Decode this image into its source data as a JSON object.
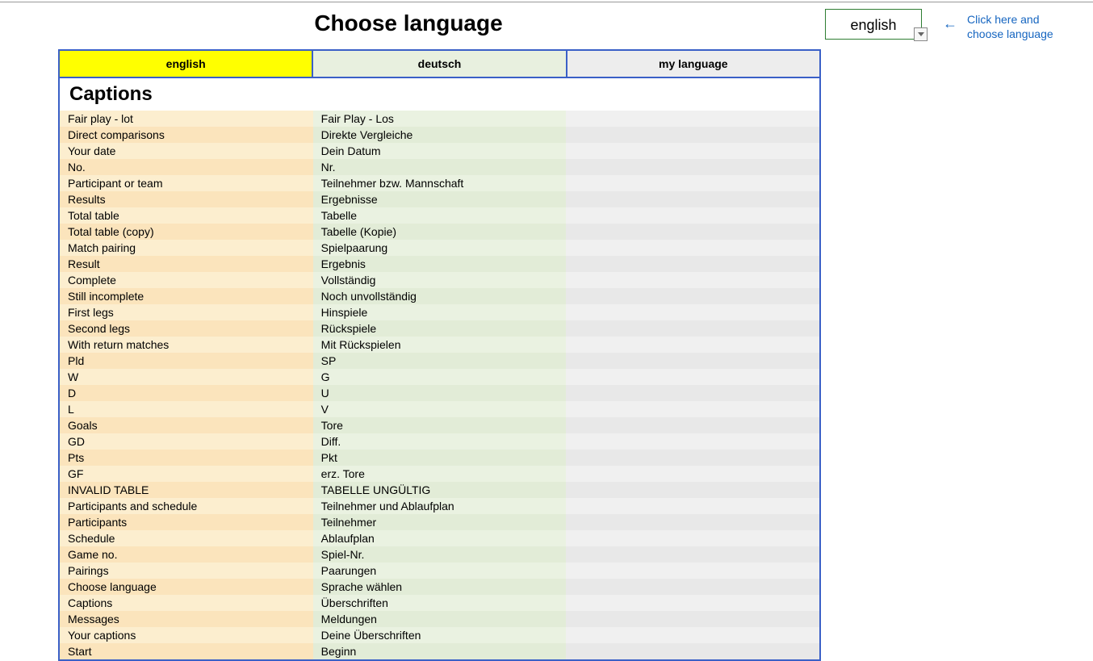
{
  "title": "Choose language",
  "language_selector": {
    "value": "english"
  },
  "hint": {
    "arrow": "←",
    "line1": "Click here and",
    "line2": "choose language"
  },
  "columns": {
    "en": "english",
    "de": "deutsch",
    "my": "my language"
  },
  "section_title": "Captions",
  "rows": [
    {
      "en": "Fair play - lot",
      "de": "Fair Play - Los",
      "my": ""
    },
    {
      "en": "Direct comparisons",
      "de": "Direkte Vergleiche",
      "my": ""
    },
    {
      "en": "Your date",
      "de": "Dein Datum",
      "my": ""
    },
    {
      "en": "No.",
      "de": "Nr.",
      "my": ""
    },
    {
      "en": "Participant or team",
      "de": "Teilnehmer bzw. Mannschaft",
      "my": ""
    },
    {
      "en": "Results",
      "de": "Ergebnisse",
      "my": ""
    },
    {
      "en": "Total table",
      "de": "Tabelle",
      "my": ""
    },
    {
      "en": "Total table (copy)",
      "de": "Tabelle (Kopie)",
      "my": ""
    },
    {
      "en": "Match pairing",
      "de": "Spielpaarung",
      "my": ""
    },
    {
      "en": "Result",
      "de": "Ergebnis",
      "my": ""
    },
    {
      "en": "Complete",
      "de": "Vollständig",
      "my": ""
    },
    {
      "en": "Still incomplete",
      "de": "Noch unvollständig",
      "my": ""
    },
    {
      "en": "First legs",
      "de": "Hinspiele",
      "my": ""
    },
    {
      "en": "Second legs",
      "de": "Rückspiele",
      "my": ""
    },
    {
      "en": "With return matches",
      "de": "Mit Rückspielen",
      "my": ""
    },
    {
      "en": "Pld",
      "de": "SP",
      "my": ""
    },
    {
      "en": "W",
      "de": "G",
      "my": ""
    },
    {
      "en": "D",
      "de": "U",
      "my": ""
    },
    {
      "en": "L",
      "de": "V",
      "my": ""
    },
    {
      "en": "Goals",
      "de": "Tore",
      "my": ""
    },
    {
      "en": "GD",
      "de": "Diff.",
      "my": ""
    },
    {
      "en": "Pts",
      "de": "Pkt",
      "my": ""
    },
    {
      "en": "GF",
      "de": "erz. Tore",
      "my": ""
    },
    {
      "en": "INVALID TABLE",
      "de": "TABELLE UNGÜLTIG",
      "my": ""
    },
    {
      "en": "Participants and schedule",
      "de": "Teilnehmer und Ablaufplan",
      "my": ""
    },
    {
      "en": "Participants",
      "de": "Teilnehmer",
      "my": ""
    },
    {
      "en": "Schedule",
      "de": "Ablaufplan",
      "my": ""
    },
    {
      "en": "Game no.",
      "de": "Spiel-Nr.",
      "my": ""
    },
    {
      "en": "Pairings",
      "de": "Paarungen",
      "my": ""
    },
    {
      "en": "Choose language",
      "de": "Sprache wählen",
      "my": ""
    },
    {
      "en": "Captions",
      "de": "Überschriften",
      "my": ""
    },
    {
      "en": "Messages",
      "de": "Meldungen",
      "my": ""
    },
    {
      "en": "Your captions",
      "de": "Deine Überschriften",
      "my": ""
    },
    {
      "en": "Start",
      "de": "Beginn",
      "my": ""
    }
  ]
}
